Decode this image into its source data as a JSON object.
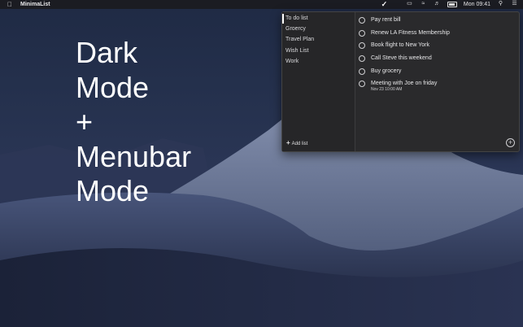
{
  "menubar": {
    "app_name": "MinimaList",
    "clock": "Mon 09:41",
    "icons": [
      "apple-icon",
      "checkmark-icon",
      "airplay-icon",
      "wifi-icon",
      "volume-icon",
      "battery-icon",
      "search-icon",
      "notification-center-icon"
    ]
  },
  "headline": {
    "lines": [
      "Dark",
      "Mode",
      "+",
      "Menubar",
      "Mode"
    ]
  },
  "sidebar": {
    "lists": [
      "To do list",
      "Groercy",
      "Travel Plan",
      "Wish List",
      "Work"
    ],
    "selected": "To do list",
    "add_list_label": "Add list"
  },
  "tasks": [
    {
      "title": "Pay rent bill"
    },
    {
      "title": "Renew LA Fitness Membership"
    },
    {
      "title": "Book flight to New York"
    },
    {
      "title": "Call Steve this weekend"
    },
    {
      "title": "Buy grocery"
    },
    {
      "title": "Meeting with Joe on friday",
      "date": "Nov 23 10:00 AM"
    }
  ],
  "colors": {
    "window_bg": "#2a2a2c",
    "sidebar_bg": "#262628",
    "menubar_bg": "#1b1c22",
    "text": "#e6e6e8"
  }
}
